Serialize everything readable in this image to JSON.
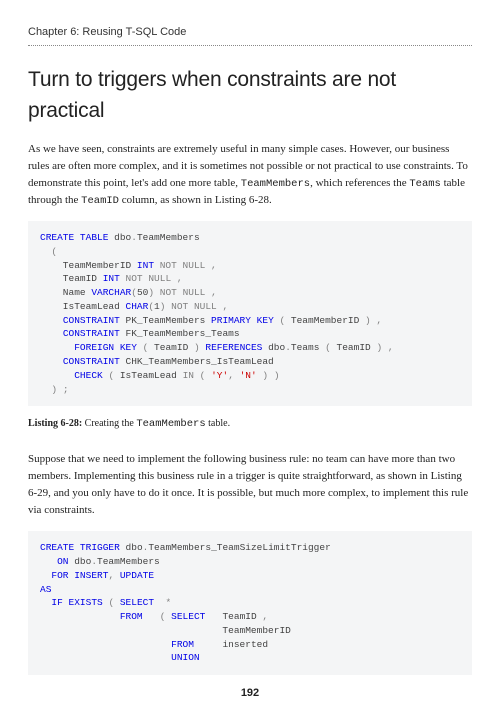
{
  "chapter": "Chapter 6: Reusing T-SQL Code",
  "heading": "Turn to triggers when constraints are not practical",
  "para1_a": "As we have seen, constraints are extremely useful in many simple cases. However, our business rules are often more complex, and it is sometimes not possible or not practical to use constraints. To demonstrate this point, let's add one more table, ",
  "para1_m1": "TeamMembers",
  "para1_b": ", which references the ",
  "para1_m2": "Teams",
  "para1_c": " table through the ",
  "para1_m3": "TeamID",
  "para1_d": " column, as shown in Listing 6-28.",
  "code1": {
    "l1a": "CREATE",
    "l1b": " ",
    "l1c": "TABLE",
    "l1d": " dbo",
    "l1e": ".",
    "l1f": "TeamMembers",
    "l2": "  (",
    "l3a": "    TeamMemberID ",
    "l3b": "INT",
    "l3c": " ",
    "l3d": "NOT",
    "l3e": " ",
    "l3f": "NULL",
    "l3g": " ,",
    "l4a": "    TeamID ",
    "l4b": "INT",
    "l4c": " ",
    "l4d": "NOT",
    "l4e": " ",
    "l4f": "NULL",
    "l4g": " ,",
    "l5a": "    Name ",
    "l5b": "VARCHAR",
    "l5c": "(",
    "l5d": "50",
    "l5e": ")",
    "l5f": " ",
    "l5g": "NOT",
    "l5h": " ",
    "l5i": "NULL",
    "l5j": " ,",
    "l6a": "    IsTeamLead ",
    "l6b": "CHAR",
    "l6c": "(",
    "l6d": "1",
    "l6e": ")",
    "l6f": " ",
    "l6g": "NOT",
    "l6h": " ",
    "l6i": "NULL",
    "l6j": " ,",
    "l7a": "    ",
    "l7b": "CONSTRAINT",
    "l7c": " PK_TeamMembers ",
    "l7d": "PRIMARY",
    "l7e": " ",
    "l7f": "KEY",
    "l7g": " ",
    "l7h": "(",
    "l7i": " TeamMemberID ",
    "l7j": ")",
    "l7k": " ,",
    "l8a": "    ",
    "l8b": "CONSTRAINT",
    "l8c": " FK_TeamMembers_Teams",
    "l9a": "      ",
    "l9b": "FOREIGN",
    "l9c": " ",
    "l9d": "KEY",
    "l9e": " ",
    "l9f": "(",
    "l9g": " TeamID ",
    "l9h": ")",
    "l9i": " ",
    "l9j": "REFERENCES",
    "l9k": " dbo",
    "l9l": ".",
    "l9m": "Teams ",
    "l9n": "(",
    "l9o": " TeamID ",
    "l9p": ")",
    "l9q": " ,",
    "l10a": "    ",
    "l10b": "CONSTRAINT",
    "l10c": " CHK_TeamMembers_IsTeamLead",
    "l11a": "      ",
    "l11b": "CHECK",
    "l11c": " ",
    "l11d": "(",
    "l11e": " IsTeamLead ",
    "l11f": "IN",
    "l11g": " ",
    "l11h": "(",
    "l11i": " ",
    "l11j": "'Y'",
    "l11k": ",",
    "l11l": " ",
    "l11m": "'N'",
    "l11n": " ",
    "l11o": ")",
    "l11p": " ",
    "l11q": ")",
    "l12a": "  ",
    "l12b": ")",
    "l12c": " ",
    "l12d": ";"
  },
  "caption1_a": "Listing 6-28:",
  "caption1_b": " Creating the ",
  "caption1_m": "TeamMembers",
  "caption1_c": " table.",
  "para2": "Suppose that we need to implement the following business rule: no team can have more than two members. Implementing this business rule in a trigger is quite straightforward, as shown in Listing 6-29, and you only have to do it once. It is possible, but much more complex, to implement this rule via constraints.",
  "code2": {
    "l1a": "CREATE",
    "l1b": " ",
    "l1c": "TRIGGER",
    "l1d": " dbo",
    "l1e": ".",
    "l1f": "TeamMembers_TeamSizeLimitTrigger",
    "l2a": "   ",
    "l2b": "ON",
    "l2c": " dbo",
    "l2d": ".",
    "l2e": "TeamMembers",
    "l3a": "  ",
    "l3b": "FOR",
    "l3c": " ",
    "l3d": "INSERT",
    "l3e": ",",
    "l3f": " ",
    "l3g": "UPDATE",
    "l4": "AS",
    "l5a": "  ",
    "l5b": "IF",
    "l5c": " ",
    "l5d": "EXISTS",
    "l5e": " ",
    "l5f": "(",
    "l5g": " ",
    "l5h": "SELECT",
    "l5i": "  ",
    "l5j": "*",
    "l6a": "              ",
    "l6b": "FROM",
    "l6c": "   ",
    "l6d": "(",
    "l6e": " ",
    "l6f": "SELECT",
    "l6g": "   TeamID ",
    "l6h": ",",
    "l7": "                                TeamMemberID",
    "l8a": "                       ",
    "l8b": "FROM",
    "l8c": "     inserted",
    "l9a": "                       ",
    "l9b": "UNION"
  },
  "pageNum": "192",
  "chart_data": null
}
